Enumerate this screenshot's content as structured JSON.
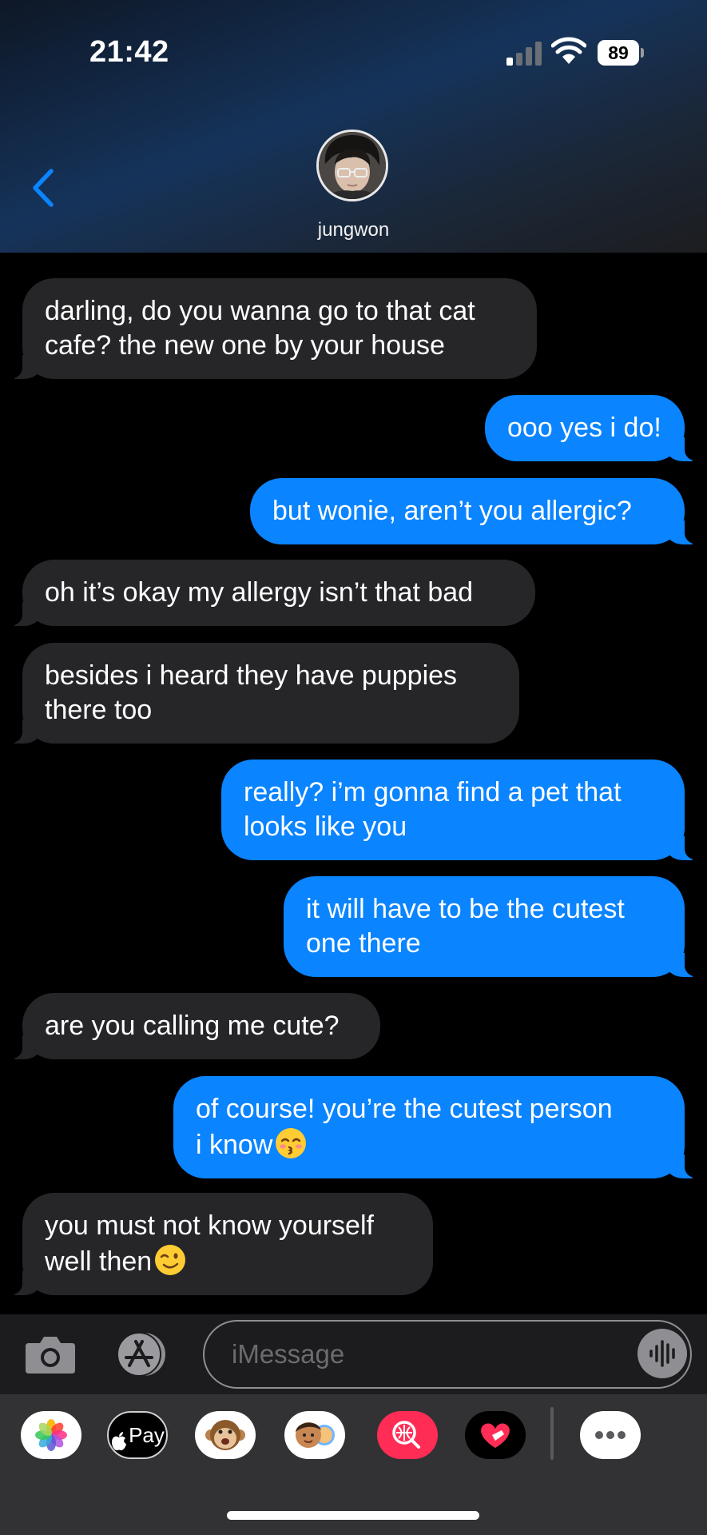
{
  "status_bar": {
    "time": "21:42",
    "battery": "89"
  },
  "contact": {
    "name": "jungwon"
  },
  "messages": [
    {
      "direction": "incoming",
      "lines": [
        "darling, do you wanna go to that cat",
        "cafe? the new one by your house"
      ]
    },
    {
      "direction": "outgoing",
      "lines": [
        "ooo yes i do!"
      ]
    },
    {
      "direction": "outgoing",
      "lines": [
        "but wonie, aren’t you allergic?"
      ]
    },
    {
      "direction": "incoming",
      "lines": [
        "oh it’s okay my allergy isn’t that bad"
      ]
    },
    {
      "direction": "incoming",
      "lines": [
        "besides i heard they have puppies",
        "there too"
      ]
    },
    {
      "direction": "outgoing",
      "lines": [
        "really? i’m gonna find a pet that",
        "looks like you"
      ]
    },
    {
      "direction": "outgoing",
      "lines": [
        "it will have to be the cutest",
        "one there"
      ]
    },
    {
      "direction": "incoming",
      "lines": [
        "are you calling me cute?"
      ]
    },
    {
      "direction": "outgoing",
      "lines": [
        "of course! you’re the cutest person",
        "i know"
      ],
      "emoji": "kissing-face-icon"
    },
    {
      "direction": "incoming",
      "lines": [
        "you must not know yourself",
        "well then"
      ],
      "emoji": "winking-face-icon"
    }
  ],
  "compose": {
    "placeholder": "iMessage"
  },
  "app_strip": {
    "apple_pay_label": "Pay",
    "apps": [
      "photos-app-icon",
      "apple-pay-app-icon",
      "animoji-app-icon",
      "memoji-app-icon",
      "image-search-app-icon",
      "digital-touch-app-icon",
      "more-apps-icon"
    ]
  },
  "colors": {
    "outgoing_bubble": "#0a84ff",
    "incoming_bubble": "#262629",
    "accent": "#0a84ff"
  }
}
